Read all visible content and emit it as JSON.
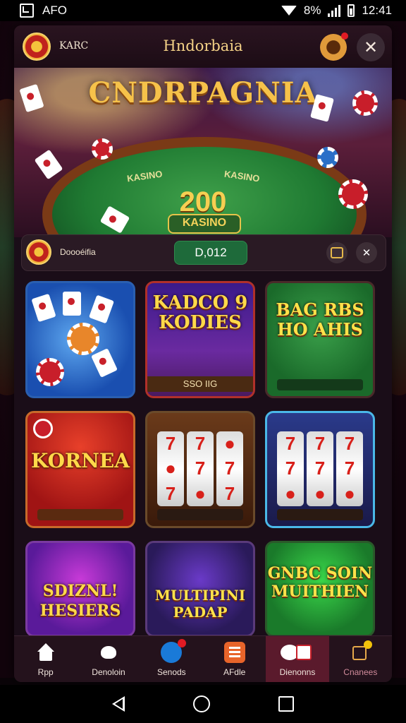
{
  "status_bar": {
    "app_label": "AFO",
    "battery": "8%",
    "time": "12:41"
  },
  "header": {
    "brand_small": "KARC",
    "title": "Hndorbaia",
    "close_symbol": "✕"
  },
  "hero": {
    "title": "CNDRPAGNIA",
    "table_label_left": "KASINO",
    "table_label_right": "KASINO",
    "amount": "200",
    "tag": "KASINO"
  },
  "balance": {
    "name": "Doooéifia",
    "amount": "D,012",
    "close_symbol": "✕"
  },
  "games": [
    {
      "title": "",
      "subtitle": ""
    },
    {
      "title": "KADCO 9 KODIES",
      "subtitle": "SSO IIG"
    },
    {
      "title": "BAG RBS HO AHIS",
      "subtitle": ""
    },
    {
      "title": "KORNEA",
      "subtitle": ""
    },
    {
      "title": "",
      "subtitle": ""
    },
    {
      "title": "",
      "subtitle": ""
    },
    {
      "title": "SDIZNL! HESIERS",
      "subtitle": ""
    },
    {
      "title": "MULTIPINI PADAP",
      "subtitle": ""
    },
    {
      "title": "GNBC SOIN MUITHIEN",
      "subtitle": ""
    }
  ],
  "bottom_nav": [
    {
      "label": "Rpp",
      "icon": "home-icon"
    },
    {
      "label": "Denoloin",
      "icon": "heart-icon"
    },
    {
      "label": "Senods",
      "icon": "games-icon"
    },
    {
      "label": "AFdle",
      "icon": "list-icon"
    },
    {
      "label": "Dienonns",
      "icon": "cards-icon"
    },
    {
      "label": "Cnanees",
      "icon": "edit-icon"
    }
  ],
  "colors": {
    "accent_gold": "#f6c24a",
    "panel": "#1a0d18",
    "active_nav": "#5a1a2c",
    "balance_green": "#1e6a3a"
  }
}
